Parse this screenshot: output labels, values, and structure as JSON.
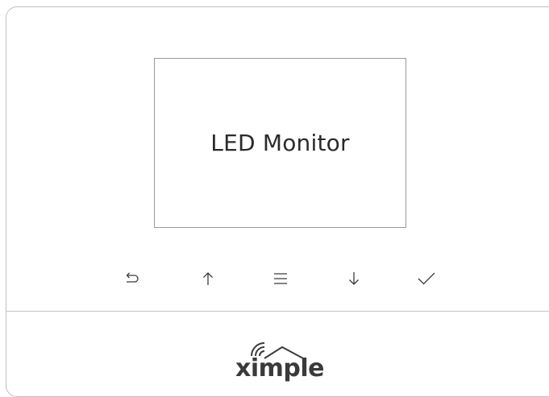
{
  "screen": {
    "label": "LED Monitor"
  },
  "controls": [
    {
      "name": "back-button",
      "icon": "back-arrow-icon"
    },
    {
      "name": "up-button",
      "icon": "arrow-up-icon"
    },
    {
      "name": "menu-button",
      "icon": "menu-icon"
    },
    {
      "name": "down-button",
      "icon": "arrow-down-icon"
    },
    {
      "name": "confirm-button",
      "icon": "checkmark-icon"
    }
  ],
  "brand": {
    "logo_text": "ximple"
  },
  "colors": {
    "icon": "#3a3a3a",
    "border": "#bfbfbf",
    "screen_border": "#9a9a9a",
    "text": "#2b2b2b"
  }
}
